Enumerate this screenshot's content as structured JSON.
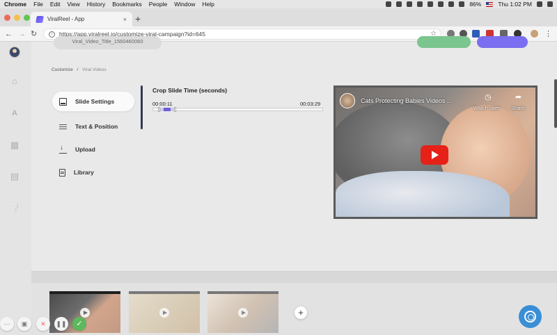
{
  "menubar": {
    "items": [
      "Chrome",
      "File",
      "Edit",
      "View",
      "History",
      "Bookmarks",
      "People",
      "Window",
      "Help"
    ],
    "battery": "86%",
    "clock": "Thu 1:02 PM"
  },
  "browser": {
    "tab_title": "ViralReel - App",
    "tab_close": "×",
    "new_tab": "+",
    "url": "https://app.viralreel.io/customize-viral-campaign?id=645",
    "traffic_colors": [
      "#ed6a5e",
      "#f5bf4f",
      "#61c554"
    ]
  },
  "header": {
    "campaign_pill": "Viral_Video_Title_1560460060"
  },
  "breadcrumb": {
    "root": "Customize",
    "sep": "/",
    "current": "Viral Videos"
  },
  "menu": {
    "items": [
      {
        "label": "Slide Settings",
        "icon": "slide-icon",
        "active": true
      },
      {
        "label": "Text & Position",
        "icon": "text-lines-icon",
        "active": false
      },
      {
        "label": "Upload",
        "icon": "upload-icon",
        "active": false
      },
      {
        "label": "Library",
        "icon": "library-icon",
        "active": false
      }
    ]
  },
  "crop": {
    "title": "Crop Slide Time (seconds)",
    "start": "00:00:11",
    "end": "00:03:29"
  },
  "video": {
    "title": "Cats Protecting Babies Videos ...",
    "watch_later": "Watch later",
    "share": "Share"
  },
  "timeline": {
    "add_label": "+"
  }
}
